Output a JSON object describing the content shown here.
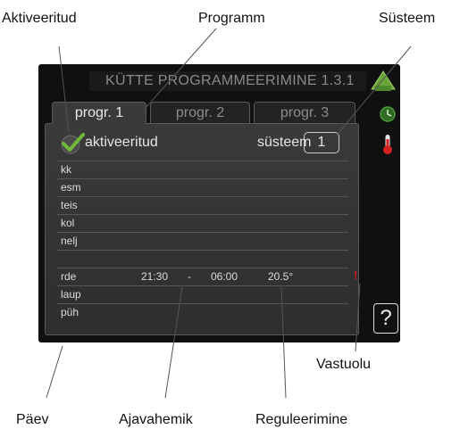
{
  "callouts": {
    "enabled": "Aktiveeritud",
    "program": "Programm",
    "system": "Süsteem",
    "conflict": "Vastuolu",
    "day": "Päev",
    "time_period": "Ajavahemik",
    "adjustment": "Reguleerimine"
  },
  "screen": {
    "title": "KÜTTE PROGRAMMEERIMINE  1.3.1",
    "tabs": [
      "progr. 1",
      "progr. 2",
      "progr. 3"
    ],
    "active_tab": 0,
    "enabled_label": "aktiveeritud",
    "system_label": "süsteem",
    "system_value": "1",
    "days": [
      {
        "label": "kk",
        "start": "",
        "dash": "",
        "end": "",
        "setting": "",
        "conflict": ""
      },
      {
        "label": "esm",
        "start": "",
        "dash": "",
        "end": "",
        "setting": "",
        "conflict": ""
      },
      {
        "label": "teis",
        "start": "",
        "dash": "",
        "end": "",
        "setting": "",
        "conflict": ""
      },
      {
        "label": "kol",
        "start": "",
        "dash": "",
        "end": "",
        "setting": "",
        "conflict": ""
      },
      {
        "label": "nelj",
        "start": "",
        "dash": "",
        "end": "",
        "setting": "",
        "conflict": ""
      },
      {
        "label": "rde",
        "start": "21:30",
        "dash": "-",
        "end": "06:00",
        "setting": "20.5°",
        "conflict": "!"
      },
      {
        "label": "laup",
        "start": "",
        "dash": "",
        "end": "",
        "setting": "",
        "conflict": ""
      },
      {
        "label": "püh",
        "start": "",
        "dash": "",
        "end": "",
        "setting": "",
        "conflict": ""
      }
    ],
    "help": "?"
  },
  "colors": {
    "accent_green": "#6fb83a",
    "warning_red": "#d01818",
    "thermometer_red": "#d32020",
    "clock_green": "#4c9a3a"
  }
}
